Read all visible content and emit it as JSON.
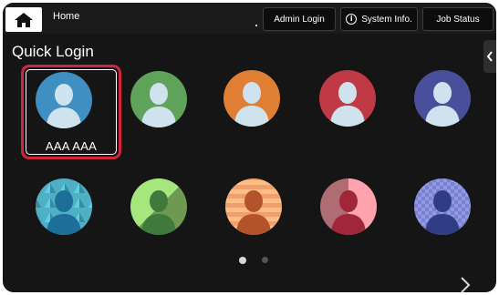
{
  "topbar": {
    "home_label": "Home",
    "admin_login_label": "Admin Login",
    "system_info_label": "System Info.",
    "job_status_label": "Job Status",
    "info_glyph": "i"
  },
  "quick_login": {
    "title": "Quick Login",
    "users": [
      {
        "name": "AAA AAA",
        "color": "#3f8fc2",
        "selected": true
      },
      {
        "name": "",
        "color": "#5fa35b"
      },
      {
        "name": "",
        "color": "#e07e33"
      },
      {
        "name": "",
        "color": "#c03a45"
      },
      {
        "name": "",
        "color": "#4a4f9c"
      },
      {
        "name": "",
        "color": "#4fb0c5",
        "pattern": "triangles"
      },
      {
        "name": "",
        "color": "#8cc46a",
        "pattern": "diagonal"
      },
      {
        "name": "",
        "color": "#f0a070",
        "pattern": "stripes"
      },
      {
        "name": "",
        "color": "#e08a94",
        "pattern": "quad"
      },
      {
        "name": "",
        "color": "#7a82c8",
        "pattern": "checker"
      }
    ]
  },
  "pager": {
    "current_page": 1,
    "total_pages": 2
  },
  "colors": {
    "background": "#151515",
    "accent_red": "#d0253b",
    "person_light": "#cfe3ee"
  },
  "icons": {
    "home": "home-icon",
    "info": "info-icon",
    "collapse": "chevron-left-icon",
    "next": "chevron-right-icon"
  }
}
